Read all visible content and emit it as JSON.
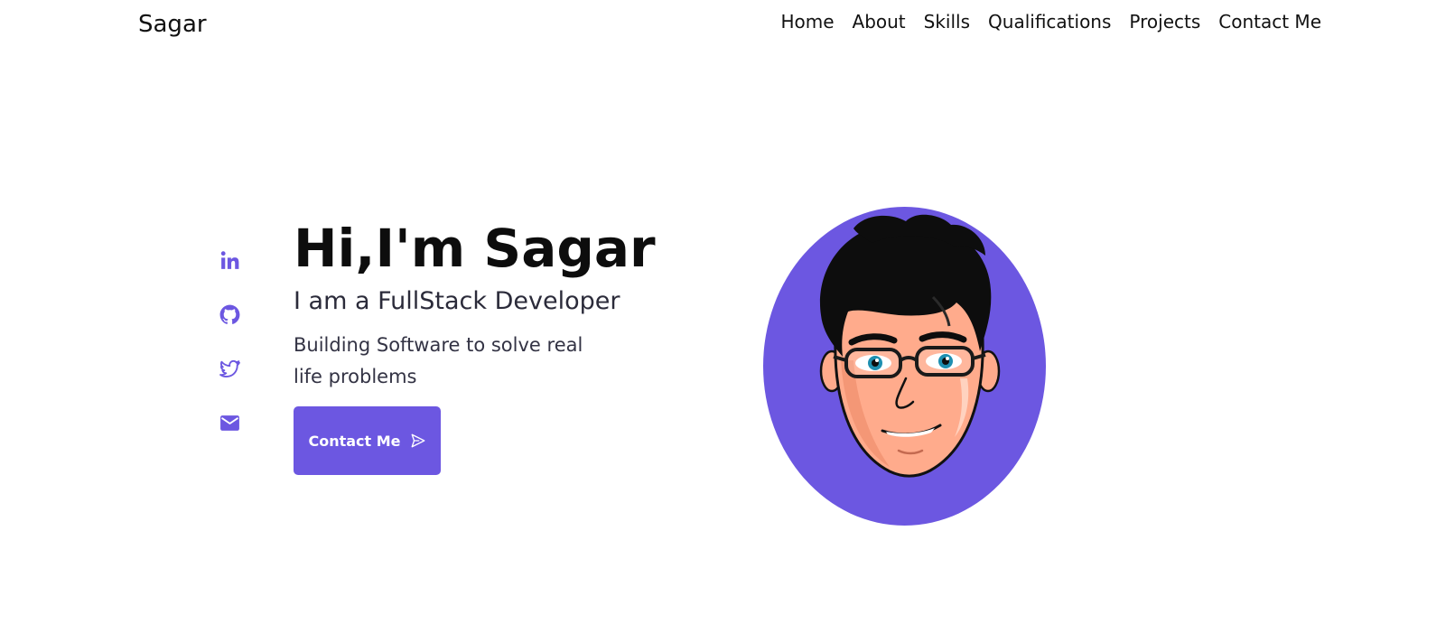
{
  "brand": {
    "name": "Sagar",
    "accent_color": "#6c57e1"
  },
  "nav": {
    "items": [
      {
        "label": "Home"
      },
      {
        "label": "About"
      },
      {
        "label": "Skills"
      },
      {
        "label": "Qualifications"
      },
      {
        "label": "Projects"
      },
      {
        "label": "Contact Me"
      }
    ]
  },
  "socials": [
    {
      "icon": "linkedin-icon"
    },
    {
      "icon": "github-icon"
    },
    {
      "icon": "twitter-icon"
    },
    {
      "icon": "mail-icon"
    }
  ],
  "hero": {
    "title": "Hi,I'm Sagar",
    "subtitle": "I am a FullStack Developer",
    "description": "Building Software to solve real life problems",
    "cta_label": "Contact Me",
    "cta_icon": "send-icon"
  },
  "avatar": {
    "icon": "avatar-cartoon"
  }
}
